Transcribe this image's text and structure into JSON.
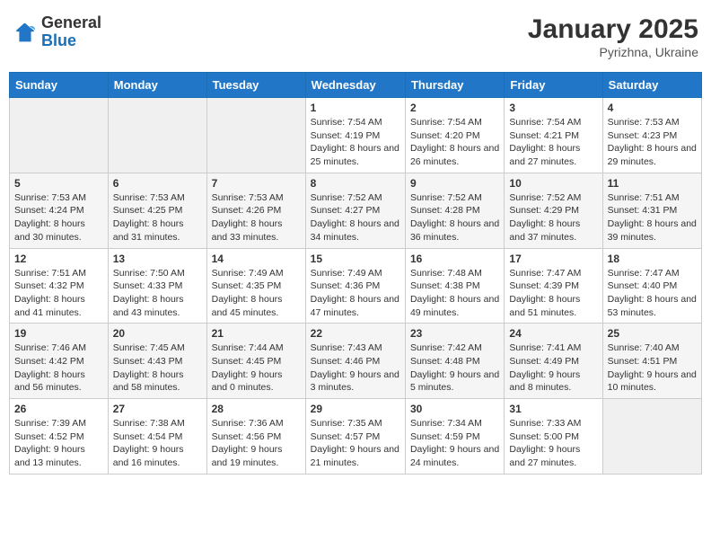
{
  "header": {
    "logo_general": "General",
    "logo_blue": "Blue",
    "month": "January 2025",
    "location": "Pyrizhna, Ukraine"
  },
  "weekdays": [
    "Sunday",
    "Monday",
    "Tuesday",
    "Wednesday",
    "Thursday",
    "Friday",
    "Saturday"
  ],
  "weeks": [
    [
      {
        "day": "",
        "content": ""
      },
      {
        "day": "",
        "content": ""
      },
      {
        "day": "",
        "content": ""
      },
      {
        "day": "1",
        "content": "Sunrise: 7:54 AM\nSunset: 4:19 PM\nDaylight: 8 hours and 25 minutes."
      },
      {
        "day": "2",
        "content": "Sunrise: 7:54 AM\nSunset: 4:20 PM\nDaylight: 8 hours and 26 minutes."
      },
      {
        "day": "3",
        "content": "Sunrise: 7:54 AM\nSunset: 4:21 PM\nDaylight: 8 hours and 27 minutes."
      },
      {
        "day": "4",
        "content": "Sunrise: 7:53 AM\nSunset: 4:23 PM\nDaylight: 8 hours and 29 minutes."
      }
    ],
    [
      {
        "day": "5",
        "content": "Sunrise: 7:53 AM\nSunset: 4:24 PM\nDaylight: 8 hours and 30 minutes."
      },
      {
        "day": "6",
        "content": "Sunrise: 7:53 AM\nSunset: 4:25 PM\nDaylight: 8 hours and 31 minutes."
      },
      {
        "day": "7",
        "content": "Sunrise: 7:53 AM\nSunset: 4:26 PM\nDaylight: 8 hours and 33 minutes."
      },
      {
        "day": "8",
        "content": "Sunrise: 7:52 AM\nSunset: 4:27 PM\nDaylight: 8 hours and 34 minutes."
      },
      {
        "day": "9",
        "content": "Sunrise: 7:52 AM\nSunset: 4:28 PM\nDaylight: 8 hours and 36 minutes."
      },
      {
        "day": "10",
        "content": "Sunrise: 7:52 AM\nSunset: 4:29 PM\nDaylight: 8 hours and 37 minutes."
      },
      {
        "day": "11",
        "content": "Sunrise: 7:51 AM\nSunset: 4:31 PM\nDaylight: 8 hours and 39 minutes."
      }
    ],
    [
      {
        "day": "12",
        "content": "Sunrise: 7:51 AM\nSunset: 4:32 PM\nDaylight: 8 hours and 41 minutes."
      },
      {
        "day": "13",
        "content": "Sunrise: 7:50 AM\nSunset: 4:33 PM\nDaylight: 8 hours and 43 minutes."
      },
      {
        "day": "14",
        "content": "Sunrise: 7:49 AM\nSunset: 4:35 PM\nDaylight: 8 hours and 45 minutes."
      },
      {
        "day": "15",
        "content": "Sunrise: 7:49 AM\nSunset: 4:36 PM\nDaylight: 8 hours and 47 minutes."
      },
      {
        "day": "16",
        "content": "Sunrise: 7:48 AM\nSunset: 4:38 PM\nDaylight: 8 hours and 49 minutes."
      },
      {
        "day": "17",
        "content": "Sunrise: 7:47 AM\nSunset: 4:39 PM\nDaylight: 8 hours and 51 minutes."
      },
      {
        "day": "18",
        "content": "Sunrise: 7:47 AM\nSunset: 4:40 PM\nDaylight: 8 hours and 53 minutes."
      }
    ],
    [
      {
        "day": "19",
        "content": "Sunrise: 7:46 AM\nSunset: 4:42 PM\nDaylight: 8 hours and 56 minutes."
      },
      {
        "day": "20",
        "content": "Sunrise: 7:45 AM\nSunset: 4:43 PM\nDaylight: 8 hours and 58 minutes."
      },
      {
        "day": "21",
        "content": "Sunrise: 7:44 AM\nSunset: 4:45 PM\nDaylight: 9 hours and 0 minutes."
      },
      {
        "day": "22",
        "content": "Sunrise: 7:43 AM\nSunset: 4:46 PM\nDaylight: 9 hours and 3 minutes."
      },
      {
        "day": "23",
        "content": "Sunrise: 7:42 AM\nSunset: 4:48 PM\nDaylight: 9 hours and 5 minutes."
      },
      {
        "day": "24",
        "content": "Sunrise: 7:41 AM\nSunset: 4:49 PM\nDaylight: 9 hours and 8 minutes."
      },
      {
        "day": "25",
        "content": "Sunrise: 7:40 AM\nSunset: 4:51 PM\nDaylight: 9 hours and 10 minutes."
      }
    ],
    [
      {
        "day": "26",
        "content": "Sunrise: 7:39 AM\nSunset: 4:52 PM\nDaylight: 9 hours and 13 minutes."
      },
      {
        "day": "27",
        "content": "Sunrise: 7:38 AM\nSunset: 4:54 PM\nDaylight: 9 hours and 16 minutes."
      },
      {
        "day": "28",
        "content": "Sunrise: 7:36 AM\nSunset: 4:56 PM\nDaylight: 9 hours and 19 minutes."
      },
      {
        "day": "29",
        "content": "Sunrise: 7:35 AM\nSunset: 4:57 PM\nDaylight: 9 hours and 21 minutes."
      },
      {
        "day": "30",
        "content": "Sunrise: 7:34 AM\nSunset: 4:59 PM\nDaylight: 9 hours and 24 minutes."
      },
      {
        "day": "31",
        "content": "Sunrise: 7:33 AM\nSunset: 5:00 PM\nDaylight: 9 hours and 27 minutes."
      },
      {
        "day": "",
        "content": ""
      }
    ]
  ]
}
